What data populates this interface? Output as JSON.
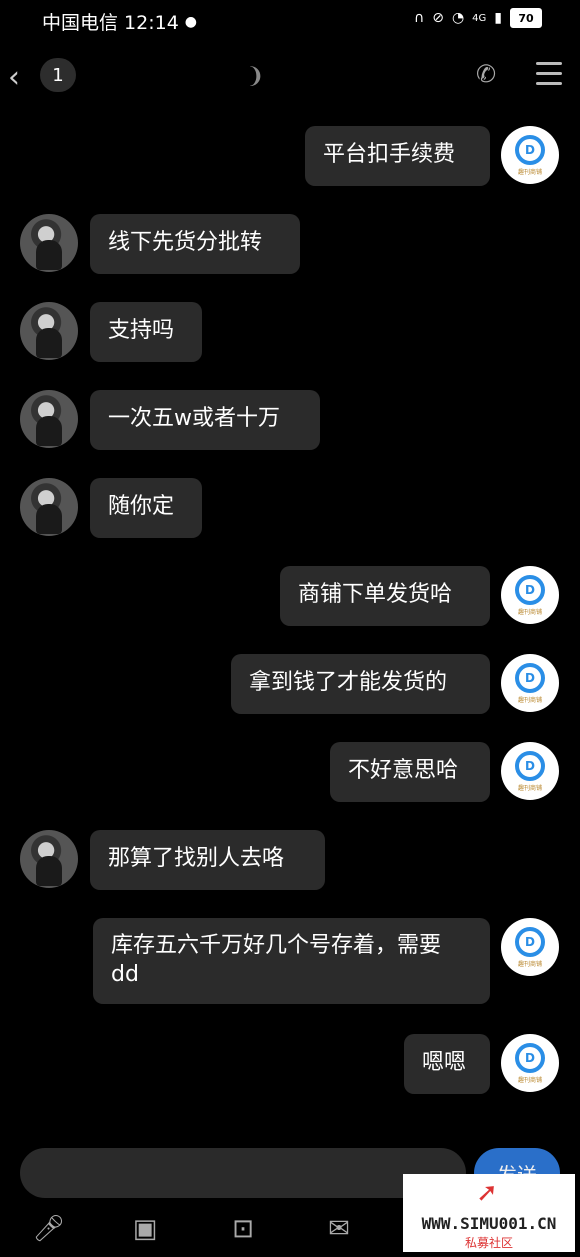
{
  "status": {
    "carrier_time": "中国电信 12:14",
    "network": "4G",
    "battery": "70"
  },
  "nav": {
    "unread_count": "1"
  },
  "messages": [
    {
      "side": "right",
      "text": "平台扣手续费"
    },
    {
      "side": "left",
      "text": "线下先货分批转"
    },
    {
      "side": "left",
      "text": "支持吗"
    },
    {
      "side": "left",
      "text": "一次五w或者十万"
    },
    {
      "side": "left",
      "text": "随你定"
    },
    {
      "side": "right",
      "text": "商铺下单发货哈"
    },
    {
      "side": "right",
      "text": "拿到钱了才能发货的"
    },
    {
      "side": "right",
      "text": "不好意思哈"
    },
    {
      "side": "left",
      "text": "那算了找别人去咯"
    },
    {
      "side": "right",
      "text": "库存五六千万好几个号存着，需要 dd"
    },
    {
      "side": "right",
      "text": "嗯嗯"
    }
  ],
  "shop_avatar_text": "趣刊商铺",
  "composer": {
    "send_label": "发送"
  },
  "watermark": {
    "url": "WWW.SIMU001.CN",
    "sub": "私募社区"
  },
  "icons": {
    "back": "chevron-left-icon",
    "ear": "ear-icon",
    "phone": "phone-icon",
    "menu": "menu-icon",
    "mic": "microphone-icon",
    "image": "image-icon",
    "camera": "camera-icon",
    "envelope": "red-packet-icon"
  },
  "colors": {
    "bubble": "#2b2b2b",
    "background": "#000000",
    "send": "#2a6fc9"
  }
}
